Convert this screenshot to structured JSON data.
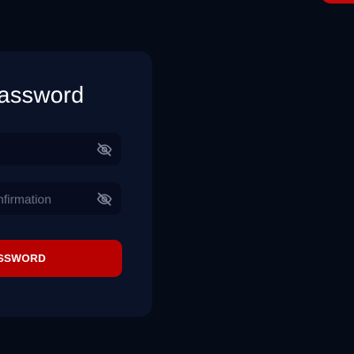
{
  "form": {
    "title": "assword",
    "password_field": {
      "value": "",
      "placeholder": "",
      "toggle_icon": "eye-slash-icon"
    },
    "confirmation_field": {
      "value": "",
      "placeholder": "nfirmation",
      "toggle_icon": "eye-slash-icon"
    },
    "submit_label": "SSWORD"
  },
  "colors": {
    "background": "#060b18",
    "card": "#0b1329",
    "input": "#070d1f",
    "accent": "#b80202"
  }
}
